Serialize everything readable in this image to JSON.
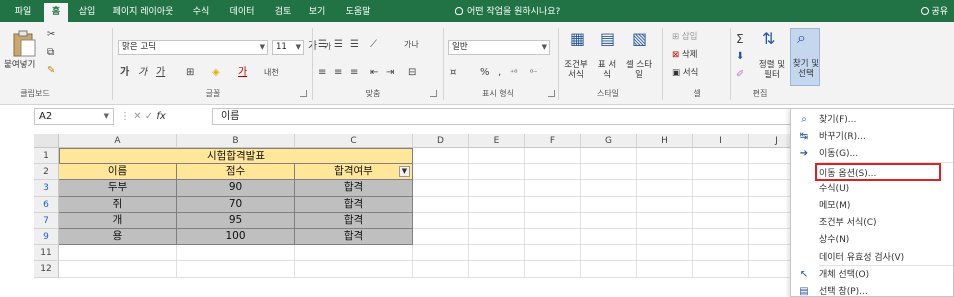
{
  "tabs": [
    "파일",
    "홈",
    "삽입",
    "페이지 레이아웃",
    "수식",
    "데이터",
    "검토",
    "보기",
    "도움말"
  ],
  "active_tab": "홈",
  "tell_me": "어떤 작업을 원하시나요?",
  "share": "공유",
  "ribbon": {
    "clipboard": {
      "paste": "붙여넣기",
      "label": "클립보드"
    },
    "font": {
      "name": "맑은 고딕",
      "size": "11",
      "grow": "가",
      "shrink": "가",
      "bold": "가",
      "italic": "가",
      "underline": "가",
      "color_a": "가",
      "phonetic": "내천",
      "label": "글꼴"
    },
    "align": {
      "wrap": "가나",
      "label": "맞춤"
    },
    "number": {
      "format": "일반",
      "percent": "%",
      "comma": ",",
      "label": "표시 형식"
    },
    "styles": {
      "conditional": "조건부 서식",
      "table": "표 서식",
      "cell_style": "셀 스타일",
      "label": "스타일"
    },
    "cells": {
      "insert": "삽입",
      "delete": "삭제",
      "format": "서식",
      "label": "셀"
    },
    "editing": {
      "sum": "Σ",
      "sort": "정렬 및 필터",
      "find": "찾기 및 선택",
      "label": "편집"
    }
  },
  "formula_bar": {
    "name_box": "A2",
    "fx": "fx",
    "value": "이름"
  },
  "columns": [
    "A",
    "B",
    "C",
    "D",
    "E",
    "F",
    "G",
    "H",
    "I",
    "J"
  ],
  "rows": [
    {
      "num": "1",
      "filtered": false
    },
    {
      "num": "2",
      "filtered": false
    },
    {
      "num": "3",
      "filtered": true
    },
    {
      "num": "6",
      "filtered": true
    },
    {
      "num": "7",
      "filtered": true
    },
    {
      "num": "9",
      "filtered": true
    },
    {
      "num": "11",
      "filtered": false
    },
    {
      "num": "12",
      "filtered": false
    }
  ],
  "table": {
    "title": "시험합격발표",
    "headers": [
      "이름",
      "점수",
      "합격여부"
    ],
    "data": [
      [
        "두부",
        "90",
        "합격"
      ],
      [
        "쥐",
        "70",
        "합격"
      ],
      [
        "개",
        "95",
        "합격"
      ],
      [
        "용",
        "100",
        "합격"
      ]
    ]
  },
  "menu": [
    {
      "label": "찾기(F)...",
      "icon": "search-icon"
    },
    {
      "label": "바꾸기(R)...",
      "icon": "replace-icon"
    },
    {
      "label": "이동(G)...",
      "icon": "arrow-right-icon"
    },
    {
      "label": "이동 옵션(S)...",
      "icon": "",
      "highlight": true
    },
    {
      "label": "수식(U)",
      "icon": ""
    },
    {
      "label": "메모(M)",
      "icon": ""
    },
    {
      "label": "조건부 서식(C)",
      "icon": ""
    },
    {
      "label": "상수(N)",
      "icon": ""
    },
    {
      "label": "데이터 유효성 검사(V)",
      "icon": ""
    },
    {
      "label": "개체 선택(O)",
      "icon": "cursor-icon"
    },
    {
      "label": "선택 창(P)...",
      "icon": "selection-pane-icon"
    }
  ],
  "colors": {
    "tab_bar": "#217346",
    "title_fill": "#ffe699",
    "data_fill": "#bfbfbf",
    "highlight_border": "#e02020"
  }
}
